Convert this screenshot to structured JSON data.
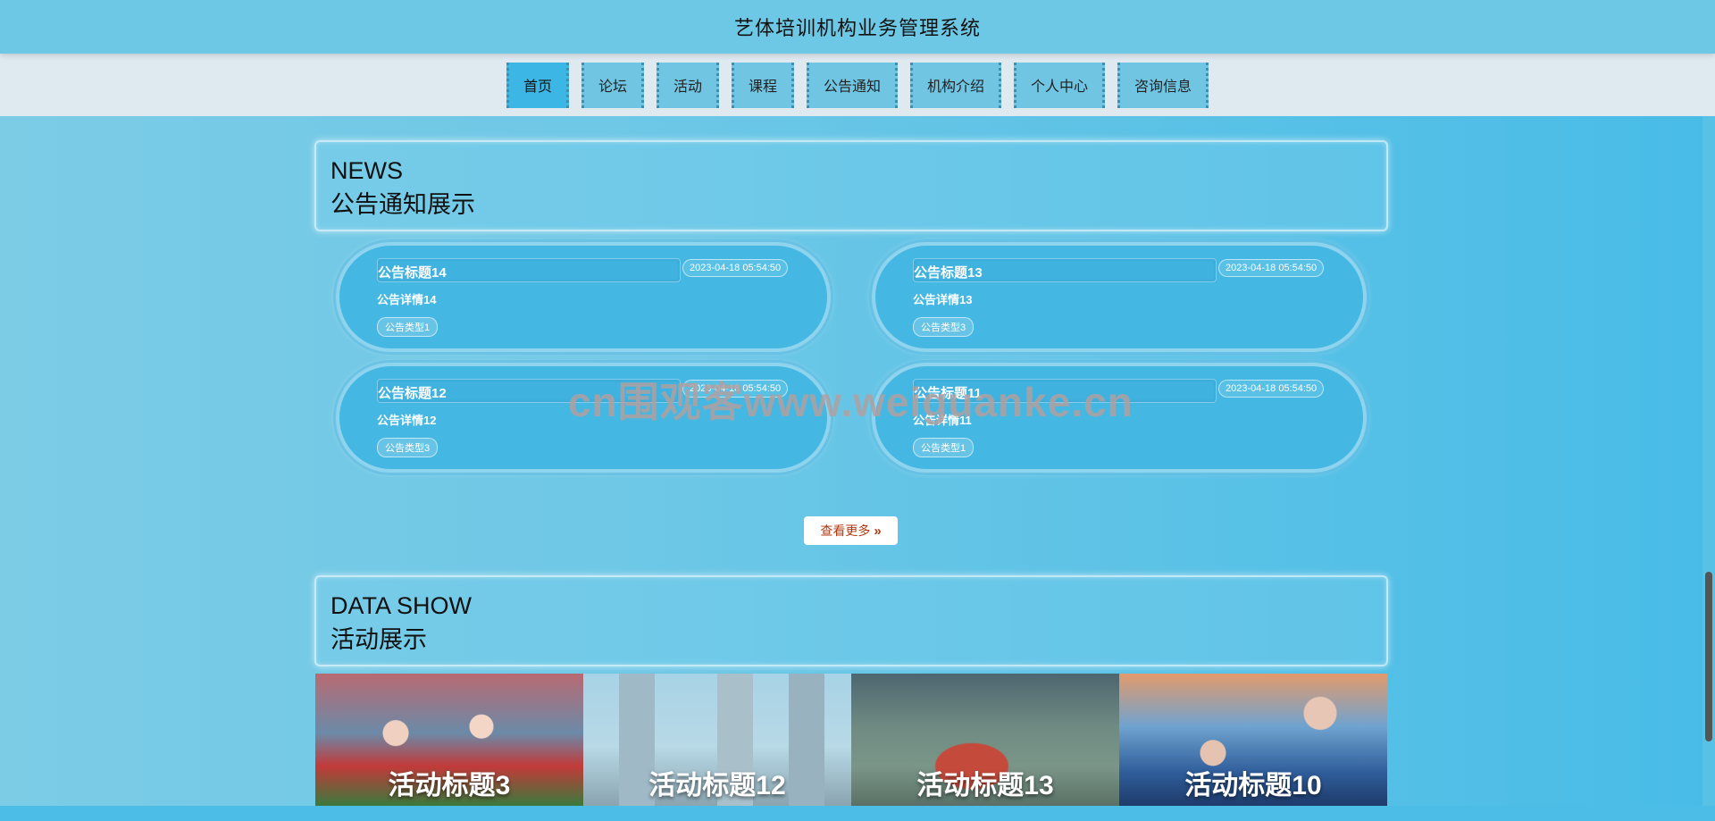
{
  "app": {
    "title": "艺体培训机构业务管理系统"
  },
  "nav": {
    "items": [
      {
        "label": "首页",
        "active": true
      },
      {
        "label": "论坛"
      },
      {
        "label": "活动"
      },
      {
        "label": "课程"
      },
      {
        "label": "公告通知"
      },
      {
        "label": "机构介绍"
      },
      {
        "label": "个人中心"
      },
      {
        "label": "咨询信息"
      }
    ]
  },
  "news": {
    "header_en": "NEWS",
    "header_cn": "公告通知展示",
    "cards": [
      {
        "title": "公告标题14",
        "date": "2023-04-18 05:54:50",
        "detail": "公告详情14",
        "type": "公告类型1"
      },
      {
        "title": "公告标题13",
        "date": "2023-04-18 05:54:50",
        "detail": "公告详情13",
        "type": "公告类型3"
      },
      {
        "title": "公告标题12",
        "date": "2023-04-18 05:54:50",
        "detail": "公告详情12",
        "type": "公告类型3"
      },
      {
        "title": "公告标题11",
        "date": "2023-04-18 05:54:50",
        "detail": "公告详情11",
        "type": "公告类型1"
      }
    ],
    "more_label": "查看更多"
  },
  "activities": {
    "header_en": "DATA SHOW",
    "header_cn": "活动展示",
    "items": [
      {
        "title": "活动标题3"
      },
      {
        "title": "活动标题12"
      },
      {
        "title": "活动标题13"
      },
      {
        "title": "活动标题10"
      }
    ]
  },
  "watermark": "cn围观客www.weiguanke.cn",
  "colors": {
    "accent": "#3cb6e4",
    "nav_bg": "#dfe9f0",
    "title_bg": "#6dc8e5",
    "more_text": "#b03a12"
  }
}
